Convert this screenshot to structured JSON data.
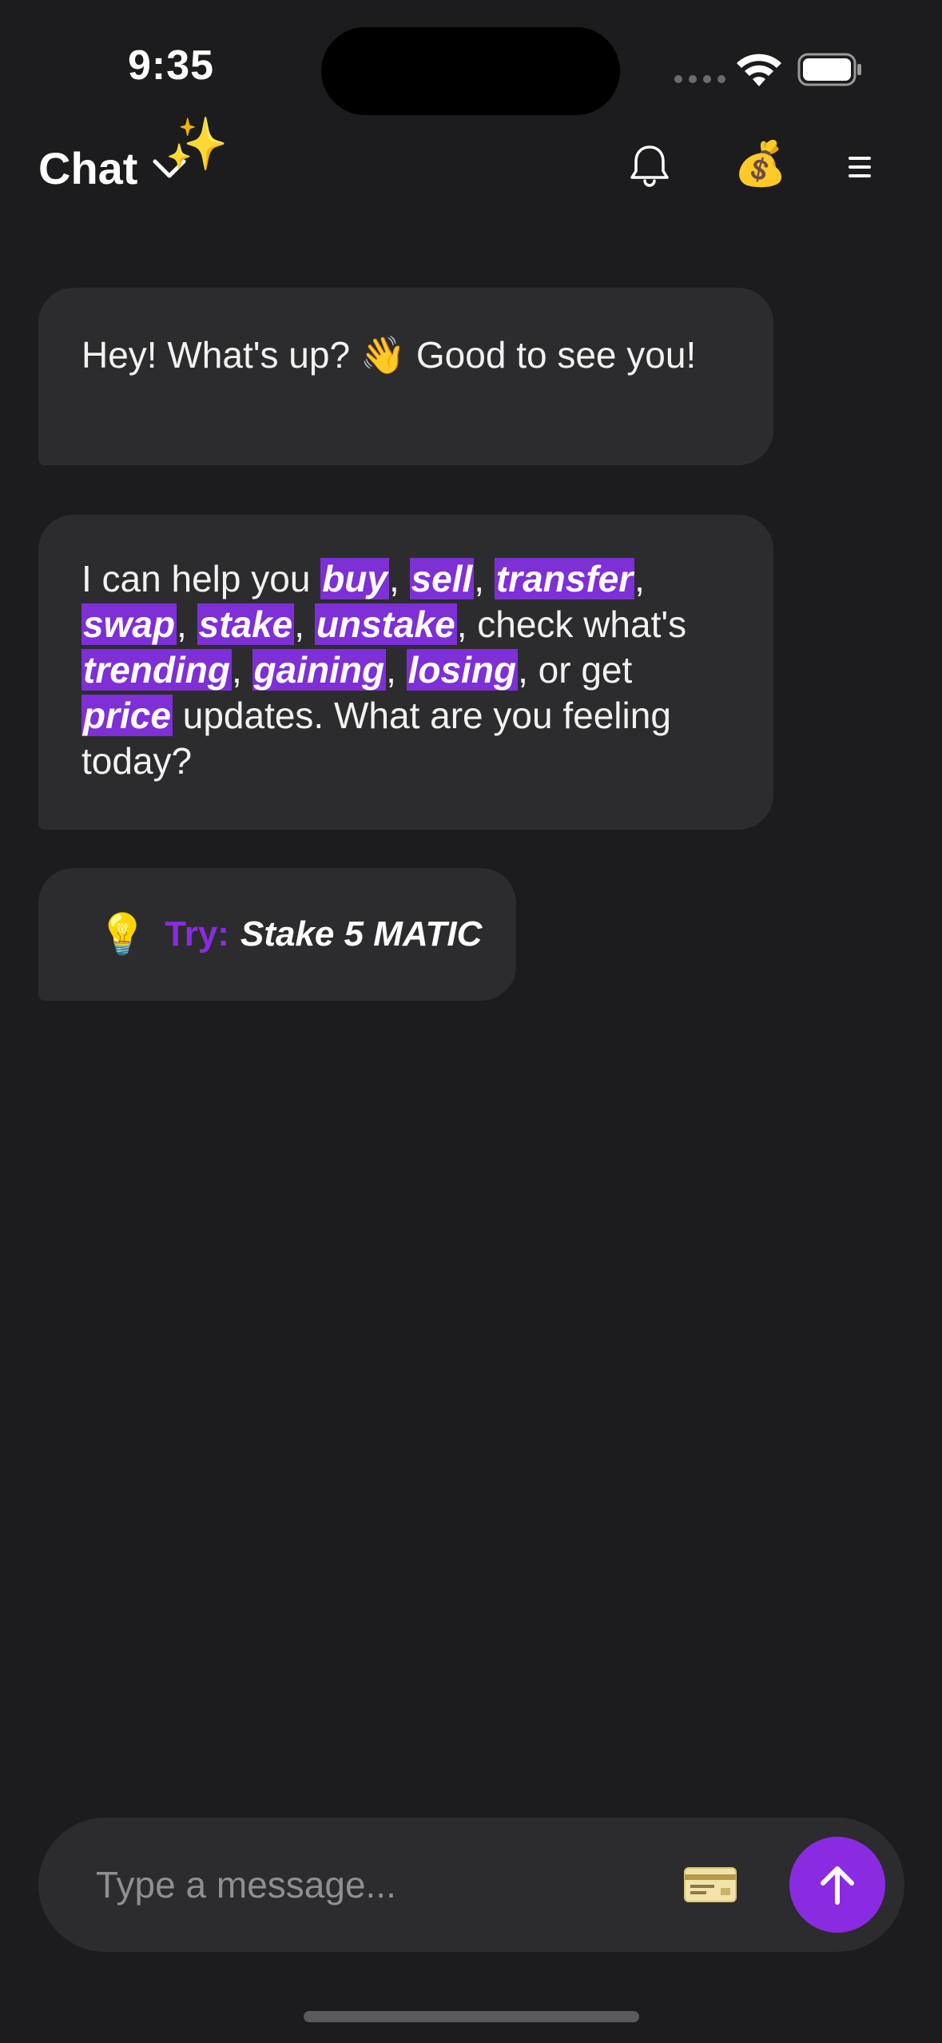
{
  "status_bar": {
    "time": "9:35"
  },
  "header": {
    "title": "Chat",
    "sparkles_icon": "✨",
    "moneybag_icon": "💰"
  },
  "messages": [
    {
      "id": "greeting",
      "text_before": "Hey! What's up? ",
      "emoji": "👋",
      "text_after": " Good to see you!"
    },
    {
      "id": "capabilities",
      "intro": "I can help you ",
      "actions": [
        "buy",
        "sell",
        "transfer",
        "swap",
        "stake",
        "unstake"
      ],
      "middle": ", check what's ",
      "trends": [
        "trending",
        "gaining",
        "losing"
      ],
      "or_get": ", or get ",
      "price": "price",
      "outro": " updates. What are you feeling today?"
    }
  ],
  "suggestion": {
    "bulb_icon": "💡",
    "label": "Try:",
    "text": "Stake 5 MATIC"
  },
  "composer": {
    "placeholder": "Type a message...",
    "accent_color": "#8a2be2"
  },
  "colors": {
    "background": "#1c1c1e",
    "bubble": "#2c2c2e",
    "highlight": "#7e2fd6"
  }
}
